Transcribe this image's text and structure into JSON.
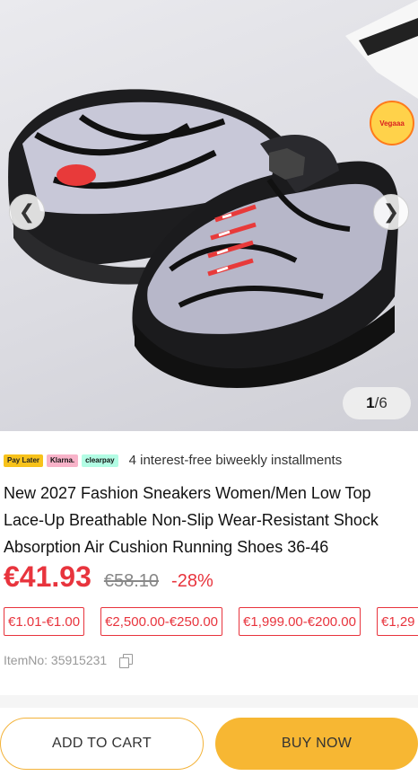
{
  "gallery": {
    "current": "1",
    "total": "/6",
    "prev_glyph": "❮",
    "next_glyph": "❯",
    "badge_text": "Vegaaa"
  },
  "payment": {
    "logos": [
      "Pay Later",
      "Klarna.",
      "clearpay"
    ],
    "text": "4 interest-free biweekly installments"
  },
  "product": {
    "title": "New 2027 Fashion Sneakers Women/Men Low Top Lace-Up Breathable Non-Slip Wear-Resistant Shock Absorption Air Cushion Running Shoes 36-46",
    "price_now": "€41.93",
    "price_old": "€58.10",
    "discount": "-28%",
    "item_no": "ItemNo: 35915231"
  },
  "coupons": [
    "€1.01-€1.00",
    "€2,500.00-€250.00",
    "€1,999.00-€200.00",
    "€1,29"
  ],
  "actions": {
    "add_to_cart": "ADD TO CART",
    "buy_now": "BUY NOW"
  },
  "colors": {
    "price_red": "#e8343d",
    "accent_orange": "#f7b733"
  }
}
